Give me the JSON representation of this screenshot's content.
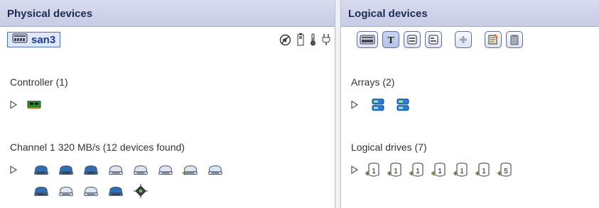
{
  "physical": {
    "header": "Physical devices",
    "device_label": "san3",
    "status_icons": [
      "no-speaker-icon",
      "battery-icon",
      "thermometer-icon",
      "power-plug-icon"
    ],
    "controller": {
      "title": "Controller (1)",
      "icons": [
        "controller-card-icon"
      ]
    },
    "channel": {
      "title": "Channel 1  320 MB/s (12 devices found)",
      "row1": [
        "disk-dark-icon",
        "disk-dark-icon",
        "disk-dark-icon",
        "disk-light-icon",
        "disk-light-icon",
        "disk-light-icon",
        "disk-light-spare-icon",
        "disk-light-icon"
      ],
      "row2": [
        "disk-dark-icon",
        "disk-light-icon",
        "disk-light-icon",
        "disk-dark-icon",
        "enclosure-chip-icon"
      ]
    }
  },
  "logical": {
    "header": "Logical devices",
    "toolbar": [
      {
        "icon": "physical-view-icon",
        "interactable": true
      },
      {
        "icon": "text-view-icon",
        "interactable": true
      },
      {
        "icon": "list-view-icon",
        "interactable": true
      },
      {
        "icon": "detail-view-icon",
        "interactable": true
      },
      {
        "icon": "add-logical-drive-icon",
        "interactable": true
      },
      {
        "icon": "task-wizard-icon",
        "interactable": true
      },
      {
        "icon": "clipboard-icon",
        "interactable": true
      }
    ],
    "arrays": {
      "title": "Arrays (2)",
      "icons": [
        "array-icon",
        "array-icon"
      ]
    },
    "logical_drives": {
      "title": "Logical drives (7)",
      "labels": [
        "1",
        "1",
        "1",
        "1",
        "1",
        "1",
        "5"
      ]
    }
  },
  "colors": {
    "header_bg": "#c7cce5",
    "header_text": "#1f2a55",
    "accent_blue": "#2e6fd0",
    "disk_dark": "#2f6fb8",
    "disk_light": "#dfe6ef"
  }
}
